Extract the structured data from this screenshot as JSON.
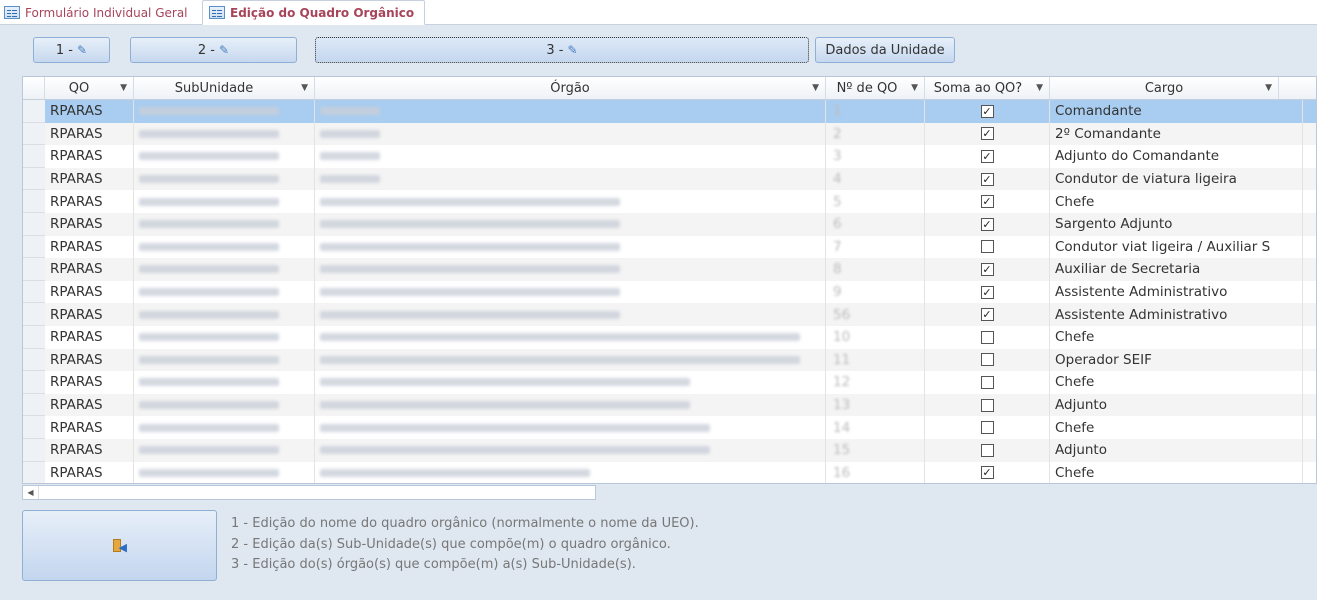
{
  "tabs": [
    {
      "label": "Formulário Individual Geral",
      "active": false
    },
    {
      "label": "Edição do Quadro Orgânico",
      "active": true
    }
  ],
  "toolbar": {
    "btn1_label": "1 -",
    "btn2_label": "2 -",
    "btn3_label": "3 -",
    "btn4_label": "Dados da Unidade",
    "pencil_icon": "pencil-icon"
  },
  "columns": [
    {
      "label": "QO"
    },
    {
      "label": "SubUnidade"
    },
    {
      "label": "Órgão"
    },
    {
      "label": "Nº de QO"
    },
    {
      "label": "Soma ao QO?"
    },
    {
      "label": "Cargo"
    }
  ],
  "rows": [
    {
      "qo": "RPARAS",
      "num": "1",
      "soma": true,
      "cargo": "Comandante",
      "selected": true
    },
    {
      "qo": "RPARAS",
      "num": "2",
      "soma": true,
      "cargo": "2º Comandante"
    },
    {
      "qo": "RPARAS",
      "num": "3",
      "soma": true,
      "cargo": "Adjunto do Comandante"
    },
    {
      "qo": "RPARAS",
      "num": "4",
      "soma": true,
      "cargo": "Condutor de viatura ligeira"
    },
    {
      "qo": "RPARAS",
      "num": "5",
      "soma": true,
      "cargo": "Chefe"
    },
    {
      "qo": "RPARAS",
      "num": "6",
      "soma": true,
      "cargo": "Sargento Adjunto"
    },
    {
      "qo": "RPARAS",
      "num": "7",
      "soma": false,
      "cargo": "Condutor viat ligeira / Auxiliar S"
    },
    {
      "qo": "RPARAS",
      "num": "8",
      "soma": true,
      "cargo": "Auxiliar de Secretaria"
    },
    {
      "qo": "RPARAS",
      "num": "9",
      "soma": true,
      "cargo": "Assistente Administrativo"
    },
    {
      "qo": "RPARAS",
      "num": "56",
      "soma": true,
      "cargo": "Assistente Administrativo"
    },
    {
      "qo": "RPARAS",
      "num": "10",
      "soma": false,
      "cargo": "Chefe"
    },
    {
      "qo": "RPARAS",
      "num": "11",
      "soma": false,
      "cargo": "Operador SEIF"
    },
    {
      "qo": "RPARAS",
      "num": "12",
      "soma": false,
      "cargo": "Chefe"
    },
    {
      "qo": "RPARAS",
      "num": "13",
      "soma": false,
      "cargo": "Adjunto"
    },
    {
      "qo": "RPARAS",
      "num": "14",
      "soma": false,
      "cargo": "Chefe"
    },
    {
      "qo": "RPARAS",
      "num": "15",
      "soma": false,
      "cargo": "Adjunto"
    },
    {
      "qo": "RPARAS",
      "num": "16",
      "soma": true,
      "cargo": "Chefe"
    }
  ],
  "notes": [
    "1 - Edição do nome do quadro orgânico (normalmente o nome da UEO).",
    "2 - Edição da(s) Sub-Unidade(s) que compõe(m) o quadro orgânico.",
    "3 - Edição do(s) órgão(s) que compõe(m) a(s) Sub-Unidade(s)."
  ]
}
